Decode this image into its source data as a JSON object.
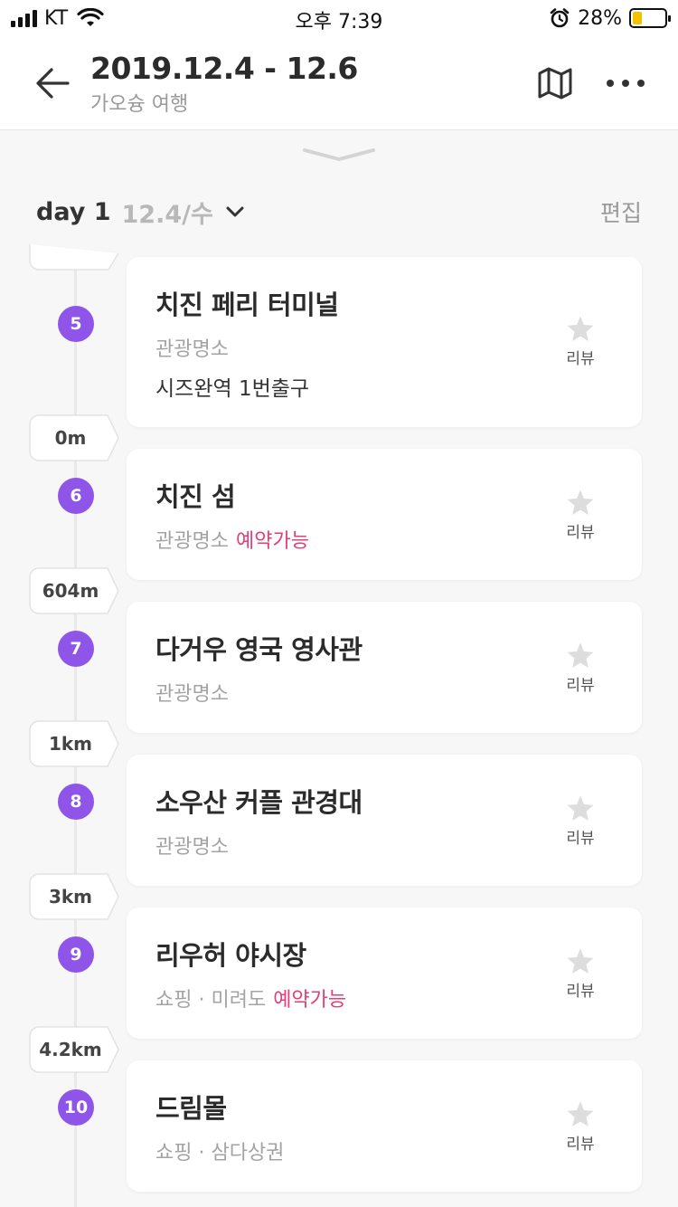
{
  "status_bar": {
    "carrier": "KT",
    "time": "오후 7:39",
    "battery": "28%",
    "battery_level": 0.28
  },
  "header": {
    "title": "2019.12.4 - 12.6",
    "subtitle": "가오슝 여행"
  },
  "day": {
    "label": "day 1",
    "date": "12.4/수",
    "edit_label": "편집"
  },
  "review_label": "리뷰",
  "distances": [
    "0m",
    "604m",
    "1km",
    "3km",
    "4.2km"
  ],
  "places": [
    {
      "number": "5",
      "name": "치진 페리 터미널",
      "category": "관광명소",
      "extra": "시즈완역 1번출구"
    },
    {
      "number": "6",
      "name": "치진 섬",
      "category": "관광명소",
      "reserve": "예약가능"
    },
    {
      "number": "7",
      "name": "다거우 영국 영사관",
      "category": "관광명소"
    },
    {
      "number": "8",
      "name": "소우산 커플 관경대",
      "category": "관광명소"
    },
    {
      "number": "9",
      "name": "리우허 야시장",
      "category": "쇼핑 · 미려도",
      "reserve": "예약가능"
    },
    {
      "number": "10",
      "name": "드림몰",
      "category": "쇼핑 · 삼다상권"
    }
  ],
  "colors": {
    "accent_purple": "#8f54e8",
    "reserve_pink": "#e0407a",
    "text_dark": "#2b2b2b",
    "text_muted": "#a3a3a3"
  }
}
